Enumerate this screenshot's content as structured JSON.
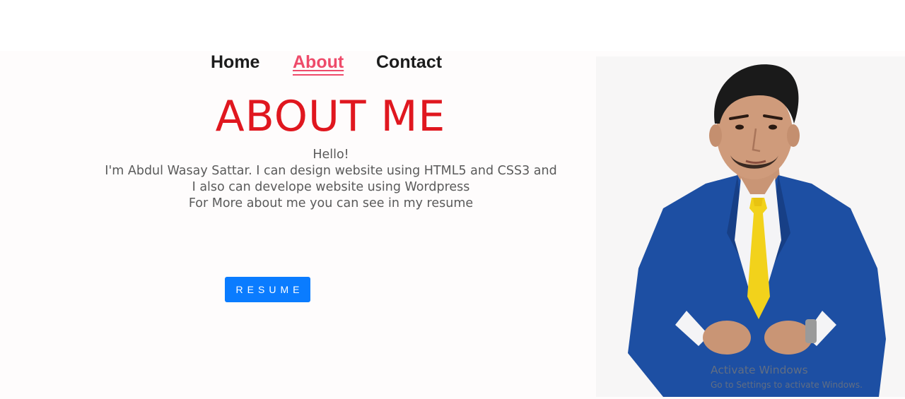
{
  "nav": {
    "home": "Home",
    "about": "About",
    "contact": "Contact"
  },
  "hero": {
    "title": "ABOUT ME",
    "lines": [
      "Hello!",
      "I'm Abdul Wasay Sattar. I can design website using HTML5 and CSS3 and",
      "I also can develope website using Wordpress",
      "For More about me you can see in my resume"
    ],
    "resume_label": "RESUME"
  },
  "watermark": {
    "title": "Activate Windows",
    "subtitle": "Go to Settings to activate Windows."
  },
  "colors": {
    "title": "#e0171f",
    "nav_active": "#ee4b6a",
    "button": "#0a7cff",
    "suit": "#1d4fa3",
    "tie": "#f2d21b"
  }
}
